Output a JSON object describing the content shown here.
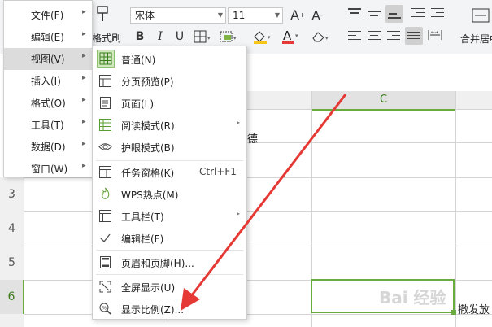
{
  "ribbon": {
    "format_painter_label": "格式刷",
    "font_name": "宋体",
    "font_size": "11",
    "merge_label": "合并居中",
    "bold": "B",
    "italic": "I",
    "underline": "U",
    "font_color": "A",
    "grow_font": "A",
    "shrink_font": "A"
  },
  "main_menu": {
    "items": [
      {
        "label": "文件(F)"
      },
      {
        "label": "编辑(E)"
      },
      {
        "label": "视图(V)"
      },
      {
        "label": "插入(I)"
      },
      {
        "label": "格式(O)"
      },
      {
        "label": "工具(T)"
      },
      {
        "label": "数据(D)"
      },
      {
        "label": "窗口(W)"
      }
    ],
    "active_index": 2
  },
  "view_menu": {
    "items": [
      {
        "label": "普通(N)",
        "icon": "grid-normal-icon"
      },
      {
        "label": "分页预览(P)",
        "icon": "page-break-preview-icon"
      },
      {
        "label": "页面(L)",
        "icon": "page-layout-icon"
      },
      {
        "label": "阅读模式(R)",
        "icon": "reading-mode-icon"
      },
      {
        "label": "护眼模式(B)",
        "icon": "eye-protection-icon"
      },
      {
        "label": "任务窗格(K)",
        "icon": "task-pane-icon",
        "shortcut": "Ctrl+F1"
      },
      {
        "label": "WPS热点(M)",
        "icon": "wps-hotspot-icon"
      },
      {
        "label": "工具栏(T)",
        "icon": "toolbar-icon"
      },
      {
        "label": "编辑栏(F)",
        "icon": "check-icon"
      },
      {
        "label": "页眉和页脚(H)...",
        "icon": "header-footer-icon"
      },
      {
        "label": "全屏显示(U)",
        "icon": "fullscreen-icon"
      },
      {
        "label": "显示比例(Z)...",
        "icon": "zoom-icon"
      }
    ]
  },
  "sheet": {
    "column_c": "C",
    "rows": [
      "3",
      "4",
      "5",
      "6"
    ],
    "cell_text_partial": "齐德",
    "cell_text_right": "撒发放"
  },
  "watermark": "Bai 经验",
  "colors": {
    "selection_green": "#6aab3d",
    "arrow_red": "#e53935",
    "menu_active": "#dcdcdc"
  }
}
